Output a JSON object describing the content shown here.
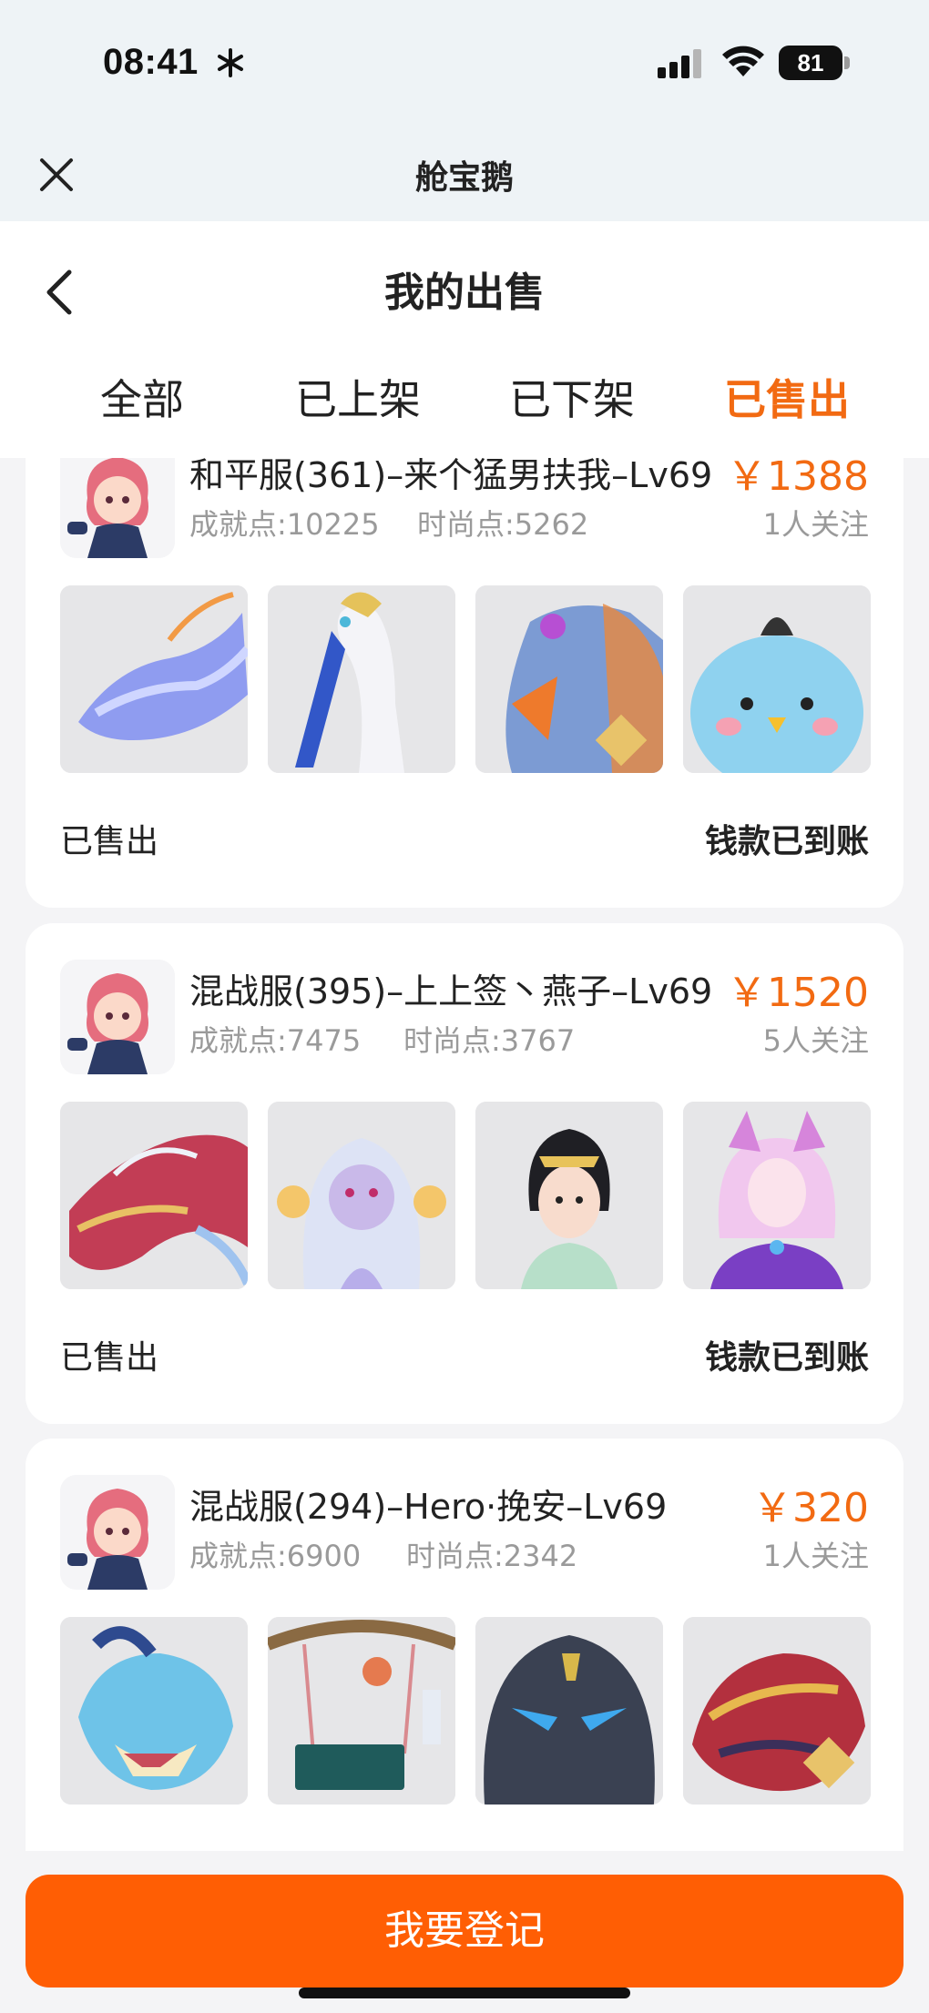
{
  "status_bar": {
    "time": "08:41",
    "battery": "81"
  },
  "webview": {
    "title": "舱宝鹅"
  },
  "page": {
    "title": "我的出售"
  },
  "tabs": [
    {
      "label": "全部",
      "active": false
    },
    {
      "label": "已上架",
      "active": false
    },
    {
      "label": "已下架",
      "active": false
    },
    {
      "label": "已售出",
      "active": true
    }
  ],
  "listings": [
    {
      "title": "和平服(361)–来个猛男扶我–Lv69",
      "price": "￥1388",
      "achievement": "成就点:10225",
      "fashion": "时尚点:5262",
      "followers": "1人关注",
      "thumbs": [
        "blue-dragon-mount",
        "white-swan-mount",
        "phoenix-mount",
        "blue-bird-pet"
      ],
      "status": "已售出",
      "payment": "钱款已到账"
    },
    {
      "title": "混战服(395)–上上签丶燕子–Lv69",
      "price": "￥1520",
      "achievement": "成就点:7475",
      "fashion": "时尚点:3767",
      "followers": "5人关注",
      "thumbs": [
        "red-dragon-mount",
        "white-spirit-pet",
        "lady-costume",
        "fox-spirit-costume"
      ],
      "status": "已售出",
      "payment": "钱款已到账"
    },
    {
      "title": "混战服(294)–Hero·挽安–Lv69",
      "price": "￥320",
      "achievement": "成就点:6900",
      "fashion": "时尚点:2342",
      "followers": "1人关注",
      "thumbs": [
        "cyan-dragon-mount",
        "swing-furniture",
        "stone-golem",
        "gold-dragon-mount"
      ],
      "status": "",
      "payment": ""
    }
  ],
  "bottom": {
    "register_label": "我要登记"
  },
  "colors": {
    "accent": "#f26a12",
    "button": "#ff5e04"
  }
}
